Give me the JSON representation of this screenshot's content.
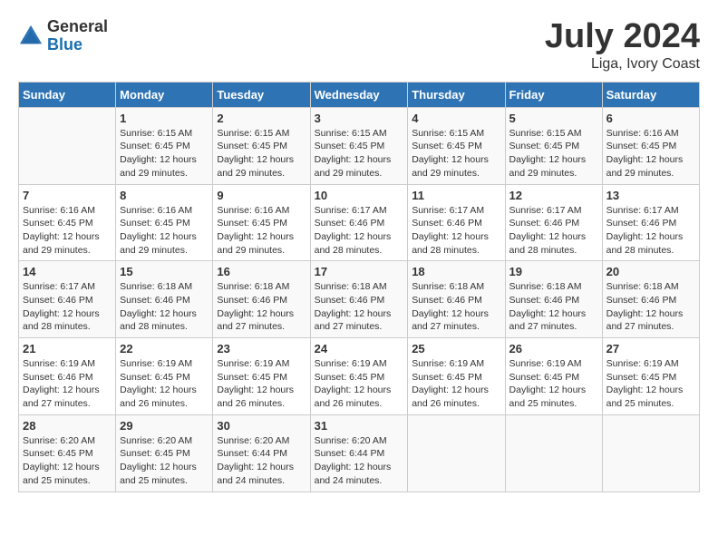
{
  "header": {
    "logo_general": "General",
    "logo_blue": "Blue",
    "month_title": "July 2024",
    "subtitle": "Liga, Ivory Coast"
  },
  "weekdays": [
    "Sunday",
    "Monday",
    "Tuesday",
    "Wednesday",
    "Thursday",
    "Friday",
    "Saturday"
  ],
  "weeks": [
    [
      {
        "day": "",
        "info": ""
      },
      {
        "day": "1",
        "info": "Sunrise: 6:15 AM\nSunset: 6:45 PM\nDaylight: 12 hours\nand 29 minutes."
      },
      {
        "day": "2",
        "info": "Sunrise: 6:15 AM\nSunset: 6:45 PM\nDaylight: 12 hours\nand 29 minutes."
      },
      {
        "day": "3",
        "info": "Sunrise: 6:15 AM\nSunset: 6:45 PM\nDaylight: 12 hours\nand 29 minutes."
      },
      {
        "day": "4",
        "info": "Sunrise: 6:15 AM\nSunset: 6:45 PM\nDaylight: 12 hours\nand 29 minutes."
      },
      {
        "day": "5",
        "info": "Sunrise: 6:15 AM\nSunset: 6:45 PM\nDaylight: 12 hours\nand 29 minutes."
      },
      {
        "day": "6",
        "info": "Sunrise: 6:16 AM\nSunset: 6:45 PM\nDaylight: 12 hours\nand 29 minutes."
      }
    ],
    [
      {
        "day": "7",
        "info": ""
      },
      {
        "day": "8",
        "info": "Sunrise: 6:16 AM\nSunset: 6:45 PM\nDaylight: 12 hours\nand 29 minutes."
      },
      {
        "day": "9",
        "info": "Sunrise: 6:16 AM\nSunset: 6:45 PM\nDaylight: 12 hours\nand 29 minutes."
      },
      {
        "day": "10",
        "info": "Sunrise: 6:17 AM\nSunset: 6:46 PM\nDaylight: 12 hours\nand 28 minutes."
      },
      {
        "day": "11",
        "info": "Sunrise: 6:17 AM\nSunset: 6:46 PM\nDaylight: 12 hours\nand 28 minutes."
      },
      {
        "day": "12",
        "info": "Sunrise: 6:17 AM\nSunset: 6:46 PM\nDaylight: 12 hours\nand 28 minutes."
      },
      {
        "day": "13",
        "info": "Sunrise: 6:17 AM\nSunset: 6:46 PM\nDaylight: 12 hours\nand 28 minutes."
      }
    ],
    [
      {
        "day": "14",
        "info": ""
      },
      {
        "day": "15",
        "info": "Sunrise: 6:18 AM\nSunset: 6:46 PM\nDaylight: 12 hours\nand 28 minutes."
      },
      {
        "day": "16",
        "info": "Sunrise: 6:18 AM\nSunset: 6:46 PM\nDaylight: 12 hours\nand 27 minutes."
      },
      {
        "day": "17",
        "info": "Sunrise: 6:18 AM\nSunset: 6:46 PM\nDaylight: 12 hours\nand 27 minutes."
      },
      {
        "day": "18",
        "info": "Sunrise: 6:18 AM\nSunset: 6:46 PM\nDaylight: 12 hours\nand 27 minutes."
      },
      {
        "day": "19",
        "info": "Sunrise: 6:18 AM\nSunset: 6:46 PM\nDaylight: 12 hours\nand 27 minutes."
      },
      {
        "day": "20",
        "info": "Sunrise: 6:18 AM\nSunset: 6:46 PM\nDaylight: 12 hours\nand 27 minutes."
      }
    ],
    [
      {
        "day": "21",
        "info": ""
      },
      {
        "day": "22",
        "info": "Sunrise: 6:19 AM\nSunset: 6:45 PM\nDaylight: 12 hours\nand 26 minutes."
      },
      {
        "day": "23",
        "info": "Sunrise: 6:19 AM\nSunset: 6:45 PM\nDaylight: 12 hours\nand 26 minutes."
      },
      {
        "day": "24",
        "info": "Sunrise: 6:19 AM\nSunset: 6:45 PM\nDaylight: 12 hours\nand 26 minutes."
      },
      {
        "day": "25",
        "info": "Sunrise: 6:19 AM\nSunset: 6:45 PM\nDaylight: 12 hours\nand 26 minutes."
      },
      {
        "day": "26",
        "info": "Sunrise: 6:19 AM\nSunset: 6:45 PM\nDaylight: 12 hours\nand 25 minutes."
      },
      {
        "day": "27",
        "info": "Sunrise: 6:19 AM\nSunset: 6:45 PM\nDaylight: 12 hours\nand 25 minutes."
      }
    ],
    [
      {
        "day": "28",
        "info": "Sunrise: 6:20 AM\nSunset: 6:45 PM\nDaylight: 12 hours\nand 25 minutes."
      },
      {
        "day": "29",
        "info": "Sunrise: 6:20 AM\nSunset: 6:45 PM\nDaylight: 12 hours\nand 25 minutes."
      },
      {
        "day": "30",
        "info": "Sunrise: 6:20 AM\nSunset: 6:44 PM\nDaylight: 12 hours\nand 24 minutes."
      },
      {
        "day": "31",
        "info": "Sunrise: 6:20 AM\nSunset: 6:44 PM\nDaylight: 12 hours\nand 24 minutes."
      },
      {
        "day": "",
        "info": ""
      },
      {
        "day": "",
        "info": ""
      },
      {
        "day": "",
        "info": ""
      }
    ]
  ],
  "week1_day7_info": "Sunrise: 6:16 AM\nSunset: 6:45 PM\nDaylight: 12 hours\nand 29 minutes.",
  "week2_day14_info": "Sunrise: 6:17 AM\nSunset: 6:46 PM\nDaylight: 12 hours\nand 28 minutes.",
  "week3_day21_info": "Sunrise: 6:19 AM\nSunset: 6:46 PM\nDaylight: 12 hours\nand 27 minutes."
}
